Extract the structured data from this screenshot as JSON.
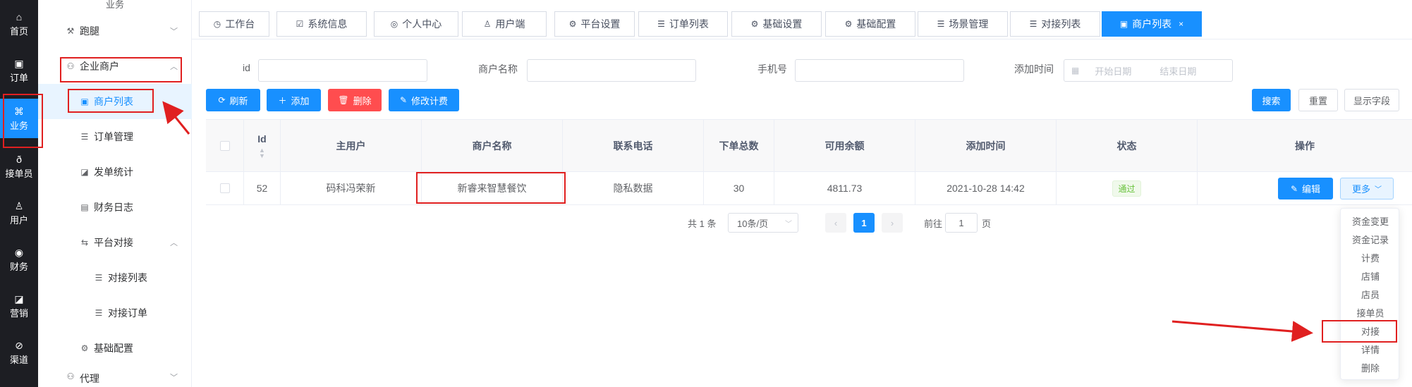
{
  "rail": [
    {
      "label": "首页",
      "icon": "home-icon",
      "glyph": "⌂"
    },
    {
      "label": "订单",
      "icon": "order-icon",
      "glyph": "▣"
    },
    {
      "label": "业务",
      "icon": "business-icon",
      "glyph": "⌘"
    },
    {
      "label": "接单员",
      "icon": "bike-icon",
      "glyph": "ð"
    },
    {
      "label": "用户",
      "icon": "user-icon",
      "glyph": "♙"
    },
    {
      "label": "财务",
      "icon": "finance-icon",
      "glyph": "◉"
    },
    {
      "label": "营销",
      "icon": "chart-icon",
      "glyph": "◪"
    },
    {
      "label": "渠道",
      "icon": "channel-icon",
      "glyph": "⊘"
    }
  ],
  "sidebar": {
    "header": "业务",
    "items": [
      {
        "label": "跑腿",
        "icon": "errand-icon",
        "glyph": "⚒",
        "arrow": "﹀"
      },
      {
        "label": "企业商户",
        "icon": "merchant-icon",
        "glyph": "⚇",
        "arrow": "︿"
      },
      {
        "label": "商户列表",
        "icon": "list-user-icon",
        "glyph": "▣"
      },
      {
        "label": "订单管理",
        "icon": "document-icon",
        "glyph": "☰"
      },
      {
        "label": "发单统计",
        "icon": "stats-icon",
        "glyph": "◪"
      },
      {
        "label": "财务日志",
        "icon": "log-icon",
        "glyph": "▤"
      },
      {
        "label": "平台对接",
        "icon": "swap-icon",
        "glyph": "⇆",
        "arrow": "︿"
      },
      {
        "label": "对接列表",
        "icon": "list-icon",
        "glyph": "☰"
      },
      {
        "label": "对接订单",
        "icon": "list-icon",
        "glyph": "☰"
      },
      {
        "label": "基础配置",
        "icon": "gear-icon",
        "glyph": "⚙"
      },
      {
        "label": "代理",
        "icon": "agent-icon",
        "glyph": "⚇",
        "arrow": "﹀"
      }
    ]
  },
  "tabs": [
    {
      "label": "工作台",
      "glyph": "◷"
    },
    {
      "label": "系统信息",
      "glyph": "☑"
    },
    {
      "label": "个人中心",
      "glyph": "◎"
    },
    {
      "label": "用户端",
      "glyph": "♙"
    },
    {
      "label": "平台设置",
      "glyph": "⚙"
    },
    {
      "label": "订单列表",
      "glyph": "☰"
    },
    {
      "label": "基础设置",
      "glyph": "⚙"
    },
    {
      "label": "基础配置",
      "glyph": "⚙"
    },
    {
      "label": "场景管理",
      "glyph": "☰"
    },
    {
      "label": "对接列表",
      "glyph": "☰"
    },
    {
      "label": "商户列表",
      "glyph": "▣",
      "close": "×"
    }
  ],
  "search": {
    "id_label": "id",
    "name_label": "商户名称",
    "phone_label": "手机号",
    "time_label": "添加时间",
    "start_placeholder": "开始日期",
    "end_placeholder": "结束日期"
  },
  "toolbar": {
    "refresh": "刷新",
    "add": "添加",
    "delete": "删除",
    "edit_billing": "修改计费",
    "search": "搜索",
    "reset": "重置",
    "show_fields": "显示字段"
  },
  "table": {
    "columns": [
      "Id",
      "主用户",
      "商户名称",
      "联系电话",
      "下单总数",
      "可用余额",
      "添加时间",
      "状态",
      "操作"
    ],
    "rows": [
      {
        "id": "52",
        "owner": "码科冯荣新",
        "name": "新睿来智慧餐饮",
        "phone": "隐私数据",
        "orders": "30",
        "balance": "4811.73",
        "time": "2021-10-28 14:42",
        "status": "通过",
        "edit": "编辑",
        "more": "更多"
      }
    ]
  },
  "pagination": {
    "total": "共 1 条",
    "page_size": "10条/页",
    "current": "1",
    "goto_prefix": "前往",
    "goto_value": "1",
    "goto_suffix": "页"
  },
  "dropdown": [
    "资金变更",
    "资金记录",
    "计费",
    "店铺",
    "店员",
    "接单员",
    "对接",
    "详情",
    "删除"
  ],
  "colors": {
    "primary": "#1890ff",
    "danger": "#ff4d4f",
    "success": "#67c23a",
    "rail_bg": "#1d1e23",
    "annotation": "#e02020"
  }
}
